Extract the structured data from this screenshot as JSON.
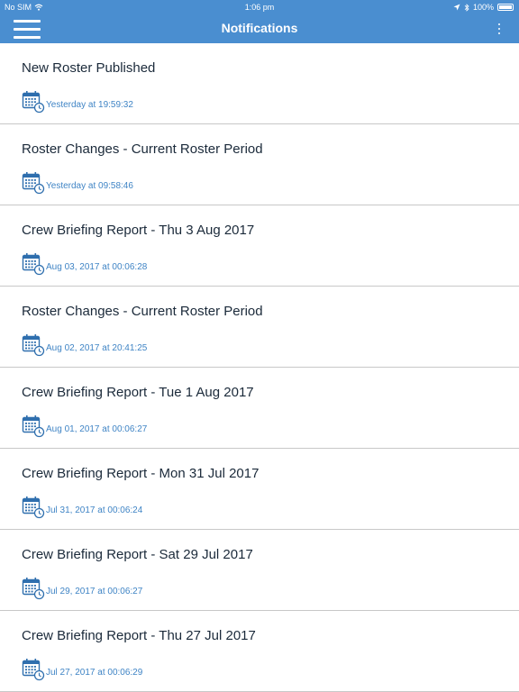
{
  "status_bar": {
    "carrier": "No SIM",
    "time": "1:06 pm",
    "battery": "100%"
  },
  "header": {
    "title": "Notifications"
  },
  "icons": {
    "menu": "hamburger-menu-icon",
    "more": "more-vertical-icon",
    "row": "calendar-clock-icon",
    "wifi": "wifi-icon",
    "location": "location-arrow-icon",
    "bluetooth": "bluetooth-icon",
    "battery": "battery-icon"
  },
  "colors": {
    "header_bg": "#4a8ed0",
    "date_text": "#3f84c5",
    "title_text": "#1b2a3a"
  },
  "notifications": [
    {
      "title": "New Roster Published",
      "date": "Yesterday at 19:59:32"
    },
    {
      "title": "Roster Changes - Current Roster Period",
      "date": "Yesterday at 09:58:46"
    },
    {
      "title": "Crew Briefing Report - Thu 3 Aug 2017",
      "date": "Aug 03, 2017 at 00:06:28"
    },
    {
      "title": "Roster Changes - Current Roster Period",
      "date": "Aug 02, 2017 at 20:41:25"
    },
    {
      "title": "Crew Briefing Report - Tue 1 Aug 2017",
      "date": "Aug 01, 2017 at 00:06:27"
    },
    {
      "title": "Crew Briefing Report - Mon 31 Jul 2017",
      "date": "Jul 31, 2017 at 00:06:24"
    },
    {
      "title": "Crew Briefing Report - Sat 29 Jul 2017",
      "date": "Jul 29, 2017 at 00:06:27"
    },
    {
      "title": "Crew Briefing Report - Thu 27 Jul 2017",
      "date": "Jul 27, 2017 at 00:06:29"
    }
  ]
}
